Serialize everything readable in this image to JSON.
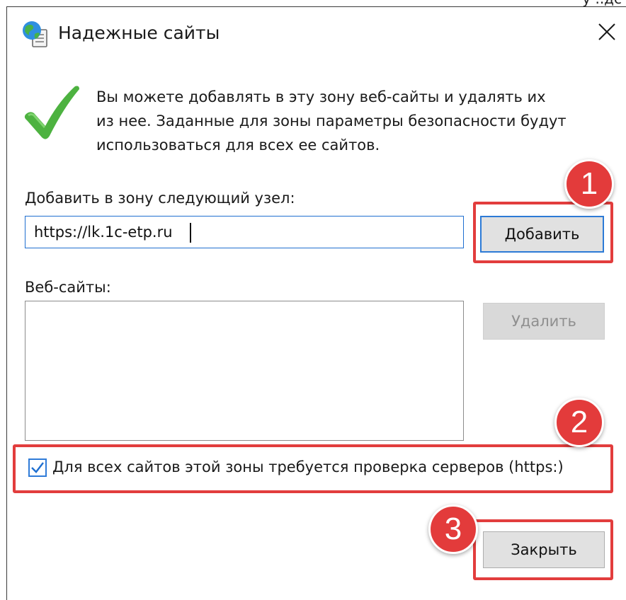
{
  "top_strip_text": "у ..дс",
  "window": {
    "title": "Надежные сайты"
  },
  "description_lines": [
    "Вы можете добавлять в эту зону  веб-сайты и удалять их",
    "из нее. Заданные для зоны параметры безопасности будут",
    "использоваться для всех ее сайтов."
  ],
  "add_zone": {
    "label": "Добавить в зону следующий узел:",
    "input_value": "https://lk.1c-etp.ru",
    "add_button": "Добавить"
  },
  "websites": {
    "label": "Веб-сайты:",
    "items": [],
    "remove_button": "Удалить"
  },
  "https_check": {
    "label": "Для всех сайтов этой зоны требуется проверка серверов (https:)",
    "checked": true
  },
  "close_button": "Закрыть",
  "annotations": [
    "1",
    "2",
    "3"
  ],
  "colors": {
    "accent_blue": "#2c7ad6",
    "highlight_red": "#e23d3d",
    "check_green": "#4db240"
  },
  "icons": {
    "title": "globe-page-icon",
    "close": "close-icon",
    "info": "checkmark-icon",
    "checkbox": "checkbox-checked-icon"
  }
}
